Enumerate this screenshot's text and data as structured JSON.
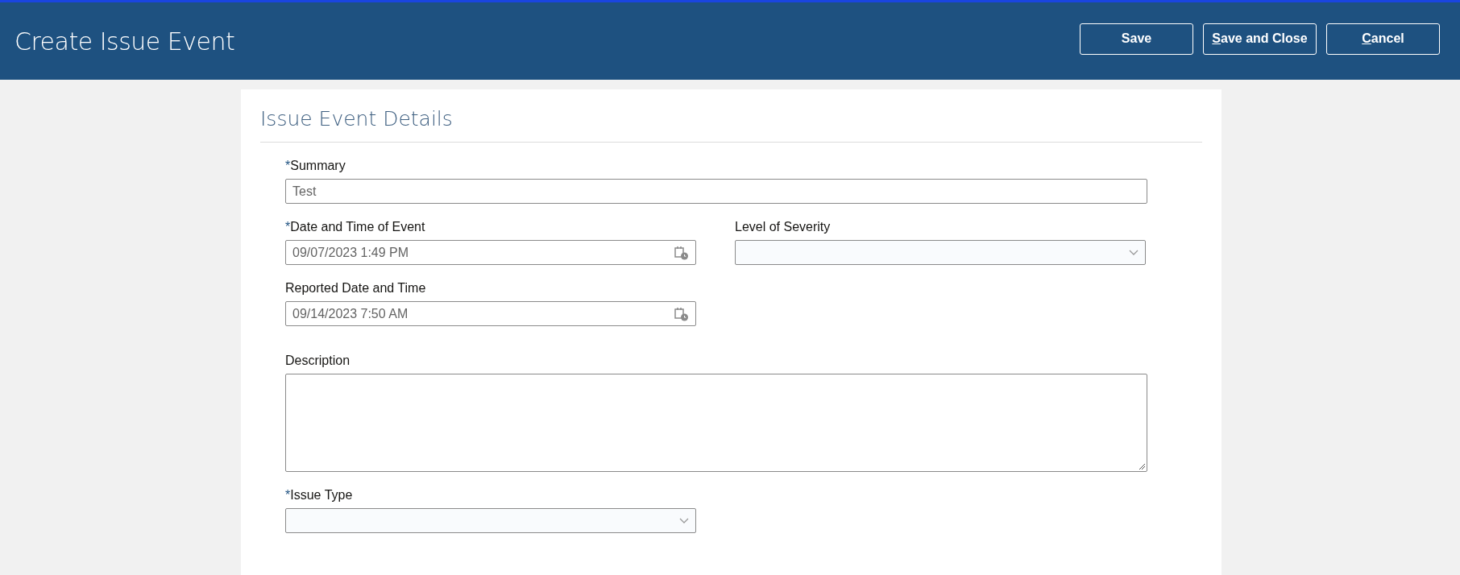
{
  "header": {
    "title": "Create Issue Event",
    "buttons": [
      {
        "label": "Save",
        "underline_first": false
      },
      {
        "label": "Save and Close",
        "underline_first": true
      },
      {
        "label": "Cancel",
        "underline_first": true
      }
    ]
  },
  "section": {
    "title": "Issue Event Details",
    "rows": [
      [
        {
          "kind": "text",
          "label": "Summary",
          "required_mark": "*",
          "value": "Test",
          "wide": true
        }
      ],
      [
        {
          "kind": "datetime",
          "label": "Date and Time of Event",
          "required_mark": "*",
          "value": "09/07/2023 1:49 PM",
          "wide": false
        },
        {
          "kind": "select",
          "label": "Level of Severity",
          "wide": false
        }
      ],
      [
        {
          "kind": "datetime",
          "label": "Reported Date and Time",
          "value": "09/14/2023 7:50 AM",
          "wide": false
        }
      ],
      [
        {
          "kind": "textarea",
          "label": "Description",
          "wide": true
        }
      ],
      [
        {
          "kind": "select",
          "label": "Issue Type",
          "required_mark": "*",
          "wide": false
        }
      ]
    ]
  }
}
